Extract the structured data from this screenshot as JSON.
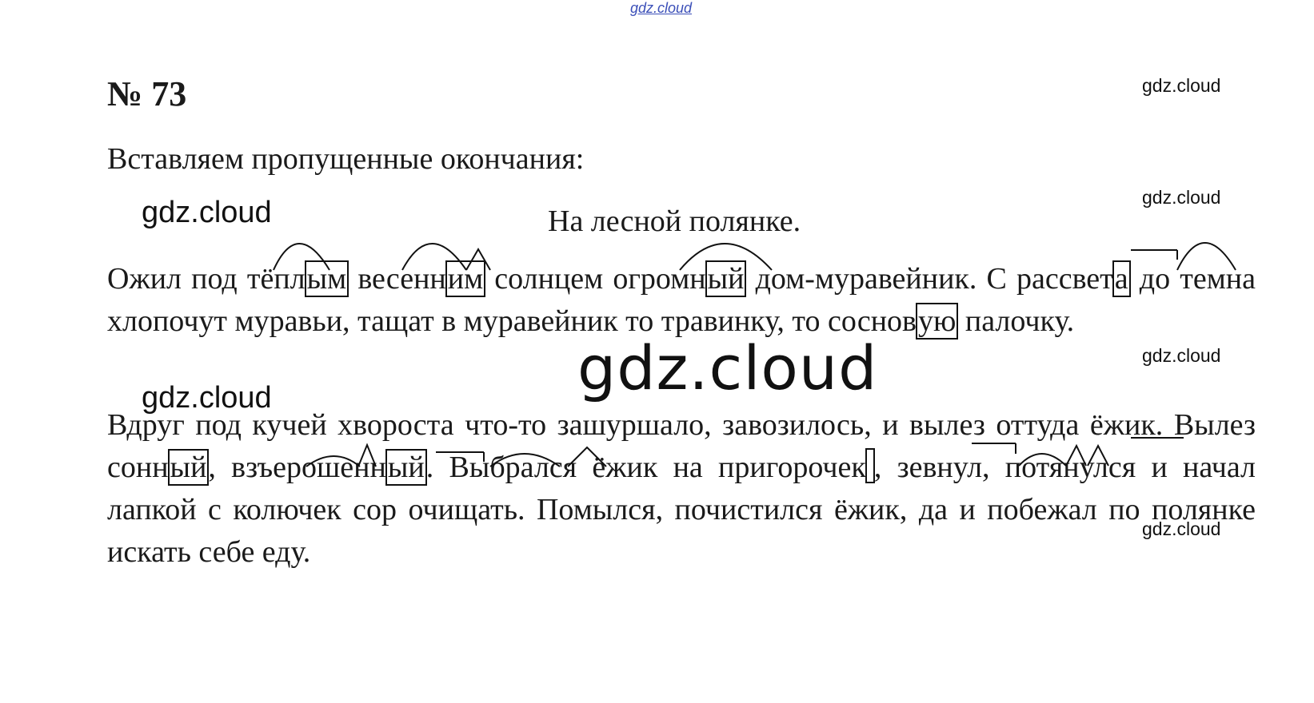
{
  "watermarks": {
    "top": "gdz.cloud",
    "label": "gdz.cloud",
    "big": "gdz.cloud"
  },
  "exercise": {
    "number": "№ 73",
    "intro": "Вставляем пропущенные окончания:",
    "title": "На лесной полянке."
  },
  "paragraph1": {
    "p1": "Ожил под тёпл",
    "e1": "ым",
    "p2": " весенн",
    "e2": "им",
    "p3": " солнцем огромн",
    "e3": "ый",
    "p4": " дом-муравейник. С рассвет",
    "e4": "а",
    "p5": " до темна хлопочут муравьи, тащат в муравейник то травинку, то соснов",
    "e5": "ую",
    "p6": " палочку."
  },
  "paragraph2": {
    "p1": "Вдруг под кучей хвороста что-то зашуршало, завозилось, и вылез оттуда ёжик. Вылез сонн",
    "e1": "ый",
    "p2": ", взъерошенн",
    "e2": "ый",
    "p3": ". Выбрался ёжик на пригорочек",
    "e3": "",
    "p4": ", зевнул, потянулся и начал лапкой с колючек сор очищать. Помылся, почистился ёжик, да и побежал по полянке искать себе еду."
  }
}
